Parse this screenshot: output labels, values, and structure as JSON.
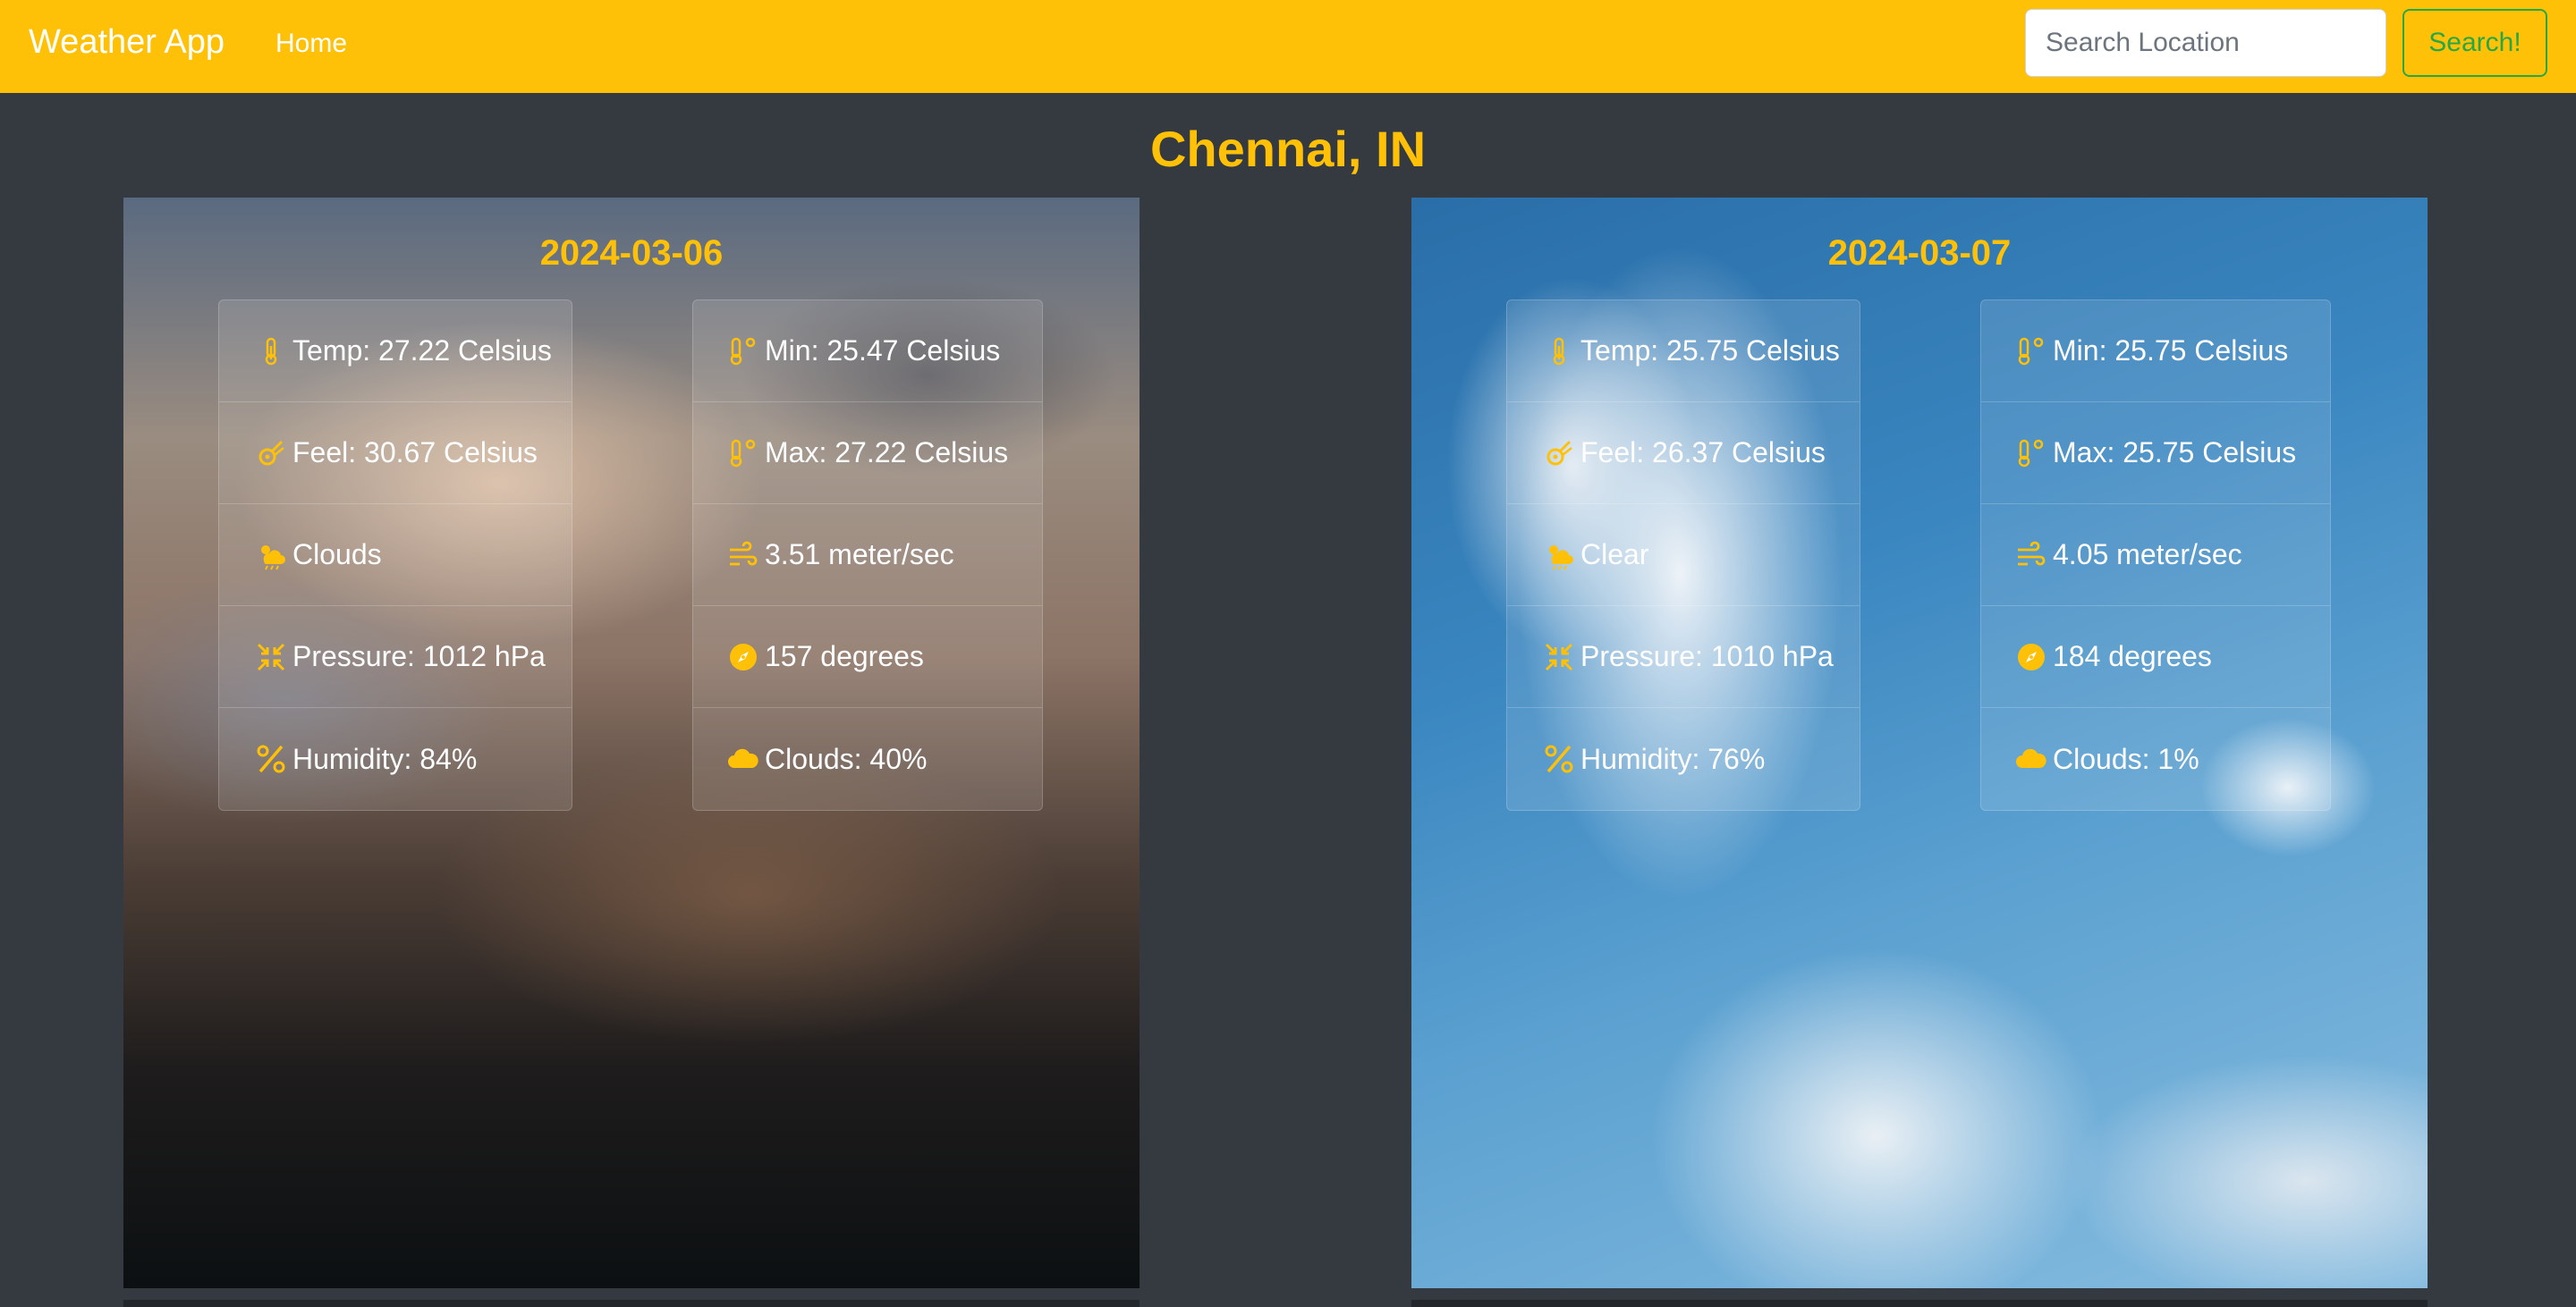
{
  "navbar": {
    "brand": "Weather App",
    "home": "Home",
    "search_placeholder": "Search Location",
    "search_button": "Search!"
  },
  "location": "Chennai, IN",
  "colors": {
    "accent": "#ffc107",
    "background": "#343a40",
    "button_outline": "#28a745"
  },
  "cards": [
    {
      "date": "2024-03-06",
      "background": "cloudy-dusk-sky",
      "left": {
        "temp": "Temp: 27.22 Celsius",
        "feel": "Feel: 30.67 Celsius",
        "condition": "Clouds",
        "pressure": "Pressure: 1012 hPa",
        "humidity": "Humidity: 84%"
      },
      "right": {
        "min": "Min: 25.47 Celsius",
        "max": "Max: 27.22 Celsius",
        "wind_speed": "3.51 meter/sec",
        "wind_deg": "157 degrees",
        "clouds": "Clouds: 40%"
      }
    },
    {
      "date": "2024-03-07",
      "background": "blue-sky-with-clouds",
      "left": {
        "temp": "Temp: 25.75 Celsius",
        "feel": "Feel: 26.37 Celsius",
        "condition": "Clear",
        "pressure": "Pressure: 1010 hPa",
        "humidity": "Humidity: 76%"
      },
      "right": {
        "min": "Min: 25.75 Celsius",
        "max": "Max: 25.75 Celsius",
        "wind_speed": "4.05 meter/sec",
        "wind_deg": "184 degrees",
        "clouds": "Clouds: 1%"
      }
    }
  ],
  "icons": {
    "temp": "thermometer-icon",
    "min": "thermometer-degree-icon",
    "max": "thermometer-degree-icon",
    "feel": "meteor-icon",
    "condition": "cloud-sun-rain-icon",
    "wind_speed": "wind-icon",
    "pressure": "compress-arrows-icon",
    "wind_deg": "compass-icon",
    "humidity": "percent-icon",
    "clouds": "cloud-icon"
  }
}
